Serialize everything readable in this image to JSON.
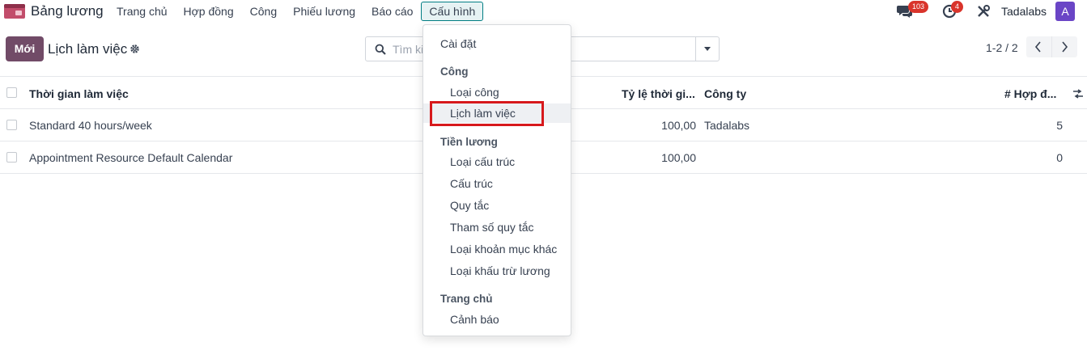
{
  "navbar": {
    "app_name": "Bảng lương",
    "menu": [
      "Trang chủ",
      "Hợp đồng",
      "Công",
      "Phiếu lương",
      "Báo cáo",
      "Cấu hình"
    ],
    "active_menu": "Cấu hình",
    "messages_count": "103",
    "activities_count": "4",
    "company": "Tadalabs",
    "avatar_letter": "A",
    "accent_color": "#714b67"
  },
  "control_panel": {
    "new_button": "Mới",
    "title": "Lịch làm việc",
    "search_placeholder": "Tìm kiếm...",
    "pager": "1-2 / 2"
  },
  "list": {
    "columns": [
      "Thời gian làm việc",
      "Tỷ lệ thời gi...",
      "Công ty",
      "# Hợp đ..."
    ],
    "rows": [
      {
        "name": "Standard 40 hours/week",
        "ratio": "100,00",
        "company": "Tadalabs",
        "contracts": "5"
      },
      {
        "name": "Appointment Resource Default Calendar",
        "ratio": "100,00",
        "company": "",
        "contracts": "0"
      }
    ]
  },
  "config_menu": {
    "settings": "Cài đặt",
    "section_cong": "Công",
    "loai_cong": "Loại công",
    "lich_lam_viec": "Lịch làm việc",
    "section_tien_luong": "Tiền lương",
    "loai_cau_truc": "Loại cấu trúc",
    "cau_truc": "Cấu trúc",
    "quy_tac": "Quy tắc",
    "tham_so_quy_tac": "Tham số quy tắc",
    "loai_khoan_muc_khac": "Loại khoản mục khác",
    "loai_khau_tru_luong": "Loại khấu trừ lương",
    "section_trang_chu": "Trang chủ",
    "canh_bao": "Cảnh báo",
    "highlighted_item": "Lịch làm việc",
    "highlight_color": "#d7191c"
  }
}
